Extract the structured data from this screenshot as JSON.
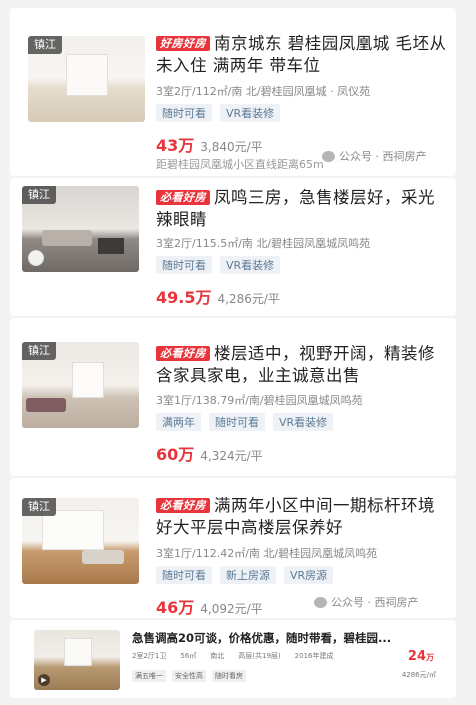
{
  "listings": [
    {
      "city_tag": "镇江",
      "badge": "好房好房",
      "title": "南京城东 碧桂园凤凰城 毛坯从未入住 满两年 带车位",
      "meta": "3室2厅/112㎡/南 北/碧桂园凤凰城 · 凤仪苑",
      "chips": [
        "随时可看",
        "VR看装修"
      ],
      "price": "43万",
      "unit_price": "3,840元/平",
      "distance": "距碧桂园凤凰城小区直线距离65m",
      "watermark": "公众号 · 西祠房产"
    },
    {
      "city_tag": "镇江",
      "badge": "必看好房",
      "title": "凤鸣三房，急售楼层好，采光辣眼睛",
      "meta": "3室2厅/115.5㎡/南 北/碧桂园凤凰城凤鸣苑",
      "chips": [
        "随时可看",
        "VR看装修"
      ],
      "price": "49.5万",
      "unit_price": "4,286元/平"
    },
    {
      "city_tag": "镇江",
      "badge": "必看好房",
      "title": "楼层适中，视野开阔，精装修含家具家电，业主诚意出售",
      "meta": "3室1厅/138.79㎡/南/碧桂园凤凰城凤鸣苑",
      "chips": [
        "满两年",
        "随时可看",
        "VR看装修"
      ],
      "price": "60万",
      "unit_price": "4,324元/平"
    },
    {
      "city_tag": "镇江",
      "badge": "必看好房",
      "title": "满两年小区中间一期标杆环境好大平层中高楼层保养好",
      "meta": "3室1厅/112.42㎡/南 北/碧桂园凤凰城凤鸣苑",
      "chips": [
        "随时可看",
        "新上房源",
        "VR房源"
      ],
      "price": "46万",
      "unit_price": "4,092元/平",
      "watermark": "公众号 · 西祠房产"
    }
  ],
  "bottom": {
    "title": "急售调高20可谈，价格优惠，随时带看，碧桂园...",
    "meta": [
      "2室2厅1卫",
      "56㎡",
      "南北",
      "高层(共19层)",
      "2016年建成"
    ],
    "chips": [
      "满五唯一",
      "安全性高",
      "随时看房"
    ],
    "price": "24",
    "price_unit": "万",
    "unit_price": "4286元/㎡"
  },
  "colors": {
    "accent": "#e8343a",
    "chip_text": "#5a7a96",
    "chip_bg": "#eef2f6"
  }
}
